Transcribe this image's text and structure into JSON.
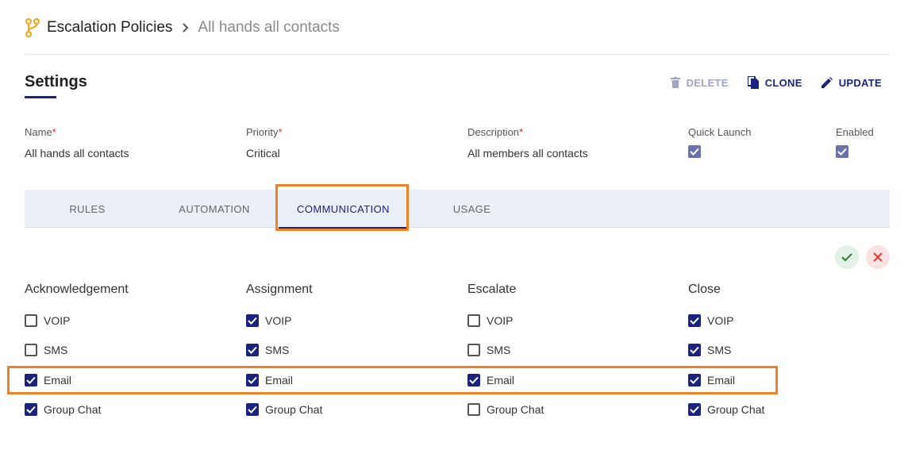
{
  "breadcrumb": {
    "root": "Escalation Policies",
    "current": "All hands all contacts",
    "icon": "git-branch-icon",
    "icon_color": "#f5a623"
  },
  "settings": {
    "title": "Settings",
    "actions": {
      "delete": "DELETE",
      "clone": "CLONE",
      "update": "UPDATE"
    }
  },
  "fields": {
    "name": {
      "label": "Name",
      "value": "All hands all contacts"
    },
    "priority": {
      "label": "Priority",
      "value": "Critical"
    },
    "description": {
      "label": "Description",
      "value": "All members all contacts"
    },
    "quick_launch": {
      "label": "Quick Launch",
      "checked": true
    },
    "enabled": {
      "label": "Enabled",
      "checked": true
    },
    "required_mark": "*"
  },
  "tabs": [
    {
      "label": "RULES",
      "active": false
    },
    {
      "label": "AUTOMATION",
      "active": false
    },
    {
      "label": "COMMUNICATION",
      "active": true
    },
    {
      "label": "USAGE",
      "active": false
    }
  ],
  "communication": {
    "columns": [
      {
        "title": "Acknowledgement",
        "options": [
          {
            "label": "VOIP",
            "checked": false
          },
          {
            "label": "SMS",
            "checked": false
          },
          {
            "label": "Email",
            "checked": true
          },
          {
            "label": "Group Chat",
            "checked": true
          }
        ]
      },
      {
        "title": "Assignment",
        "options": [
          {
            "label": "VOIP",
            "checked": true
          },
          {
            "label": "SMS",
            "checked": true
          },
          {
            "label": "Email",
            "checked": true
          },
          {
            "label": "Group Chat",
            "checked": true
          }
        ]
      },
      {
        "title": "Escalate",
        "options": [
          {
            "label": "VOIP",
            "checked": false
          },
          {
            "label": "SMS",
            "checked": false
          },
          {
            "label": "Email",
            "checked": true
          },
          {
            "label": "Group Chat",
            "checked": false
          }
        ]
      },
      {
        "title": "Close",
        "options": [
          {
            "label": "VOIP",
            "checked": true
          },
          {
            "label": "SMS",
            "checked": true
          },
          {
            "label": "Email",
            "checked": true
          },
          {
            "label": "Group Chat",
            "checked": true
          }
        ]
      }
    ]
  },
  "colors": {
    "primary": "#1a237e",
    "highlight": "#f08026",
    "tab_bar": "#eaeff8",
    "required": "#d32f2f"
  }
}
